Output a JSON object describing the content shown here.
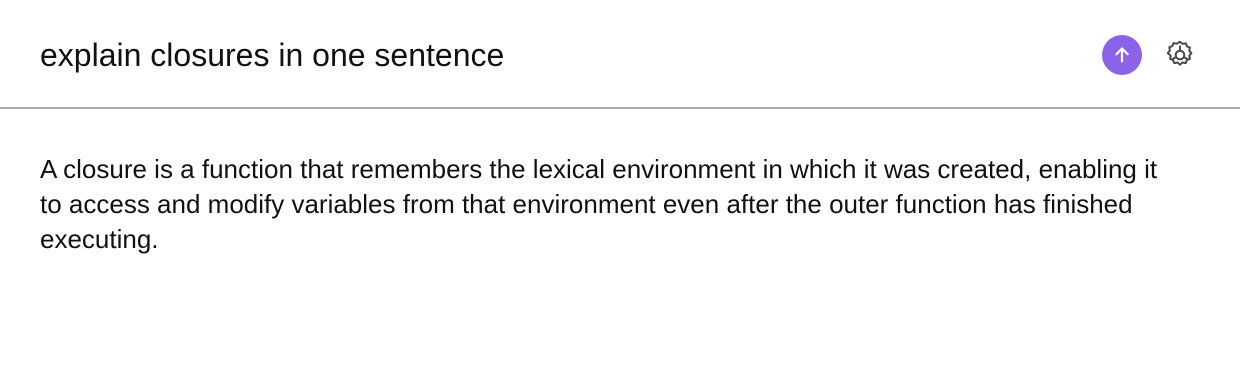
{
  "prompt": {
    "value": "explain closures in one sentence",
    "send_icon": "arrow-up-icon",
    "settings_icon": "gear-icon",
    "accent_color": "#8a63e8"
  },
  "response": {
    "text": "A closure is a function that remembers the lexical environment in which it was created, enabling it to access and modify variables from that environment even after the outer function has finished executing."
  }
}
